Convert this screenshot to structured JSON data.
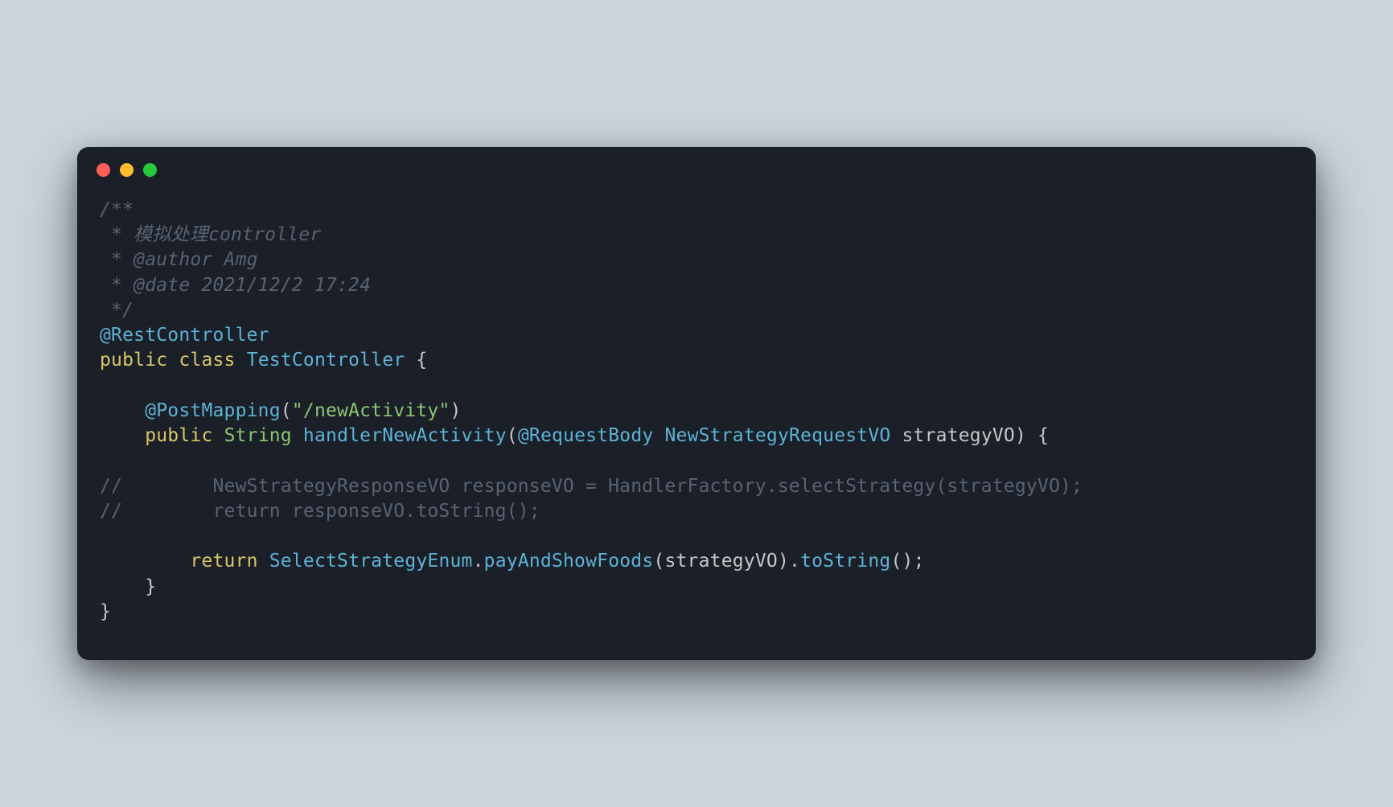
{
  "code": {
    "comment_open": "/**",
    "comment_line1": " * 模拟处理controller",
    "comment_line2": " * @author Amg",
    "comment_line3": " * @date 2021/12/2 17:24",
    "comment_close": " */",
    "annotation_rest": "@RestController",
    "kw_public1": "public",
    "kw_class": "class",
    "class_name": "TestController",
    "brace_open": " {",
    "annotation_post": "@PostMapping",
    "paren_open": "(",
    "route_string": "\"/newActivity\"",
    "paren_close": ")",
    "kw_public2": "public",
    "return_type": "String",
    "method_name": "handlerNewActivity",
    "annotation_reqbody": "@RequestBody",
    "param_type": "NewStrategyRequestVO",
    "param_name": "strategyVO",
    "method_close": ") {",
    "commented_line1": "//        NewStrategyResponseVO responseVO = HandlerFactory.selectStrategy(strategyVO);",
    "commented_line2": "//        return responseVO.toString();",
    "kw_return": "return",
    "enum_class": "SelectStrategyEnum",
    "dot1": ".",
    "enum_method": "payAndShowFoods",
    "call_open": "(",
    "arg_name": "strategyVO",
    "call_close": ")",
    "dot2": ".",
    "tostring": "toString",
    "empty_call": "()",
    "semicolon": ";",
    "inner_brace_close": "    }",
    "outer_brace_close": "}"
  }
}
